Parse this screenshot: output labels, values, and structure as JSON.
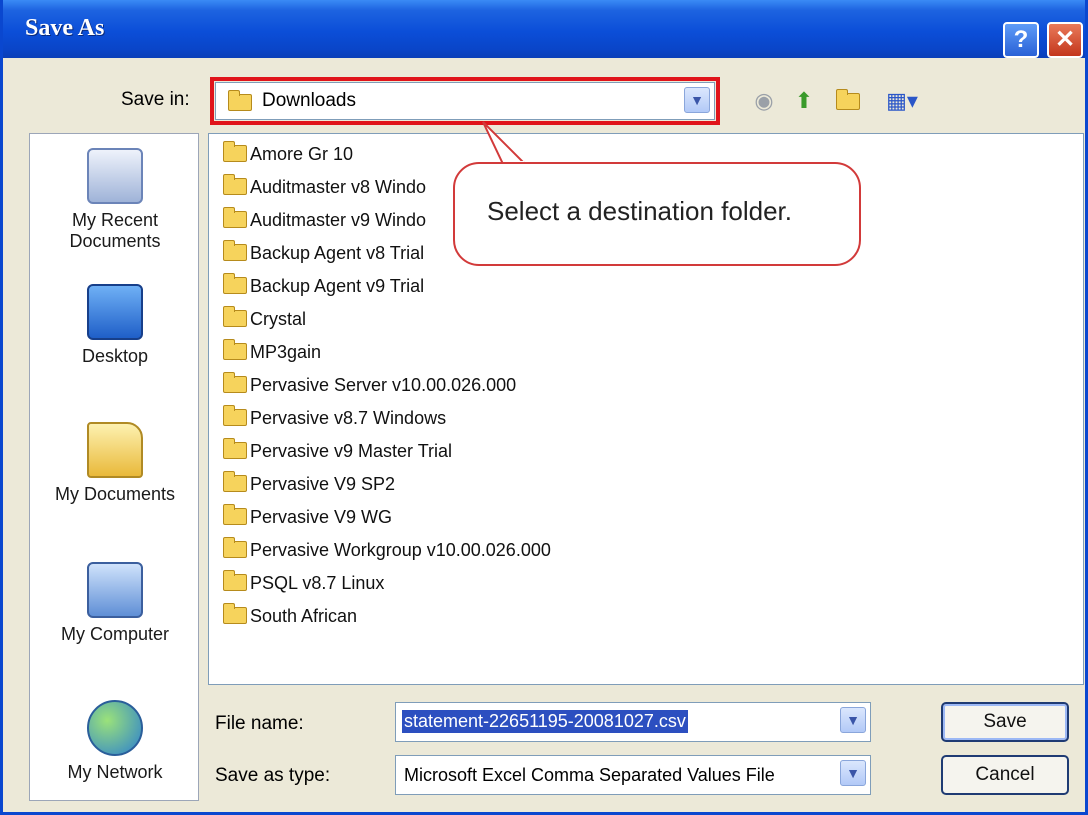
{
  "window": {
    "title": "Save As",
    "help_label": "?",
    "close_label": "✕"
  },
  "save_in": {
    "label": "Save in:",
    "value": "Downloads"
  },
  "toolbar": [
    "back-icon",
    "up-folder-icon",
    "new-folder-icon",
    "views-menu-icon"
  ],
  "places": [
    {
      "label": "My Recent Documents"
    },
    {
      "label": "Desktop"
    },
    {
      "label": "My Documents"
    },
    {
      "label": "My Computer"
    },
    {
      "label": "My Network"
    }
  ],
  "files": [
    "Amore Gr 10",
    "Auditmaster v8 Windo",
    "Auditmaster v9 Windo",
    "Backup Agent v8 Trial",
    "Backup Agent v9 Trial",
    "Crystal",
    "MP3gain",
    "Pervasive Server v10.00.026.000",
    "Pervasive v8.7 Windows",
    "Pervasive v9 Master Trial",
    "Pervasive V9 SP2",
    "Pervasive V9 WG",
    "Pervasive Workgroup v10.00.026.000",
    "PSQL v8.7 Linux",
    "South African"
  ],
  "callout": {
    "text": "Select a destination folder."
  },
  "file_name": {
    "label": "File name:",
    "value": "statement-22651195-20081027.csv"
  },
  "save_as_type": {
    "label": "Save as type:",
    "value": "Microsoft Excel Comma Separated Values File"
  },
  "buttons": {
    "save": "Save",
    "cancel": "Cancel"
  },
  "colors": {
    "titlebar": "#0b4ed8",
    "highlight": "#e0141a",
    "callout_border": "#d23a3a",
    "selection": "#2c4fc0"
  }
}
